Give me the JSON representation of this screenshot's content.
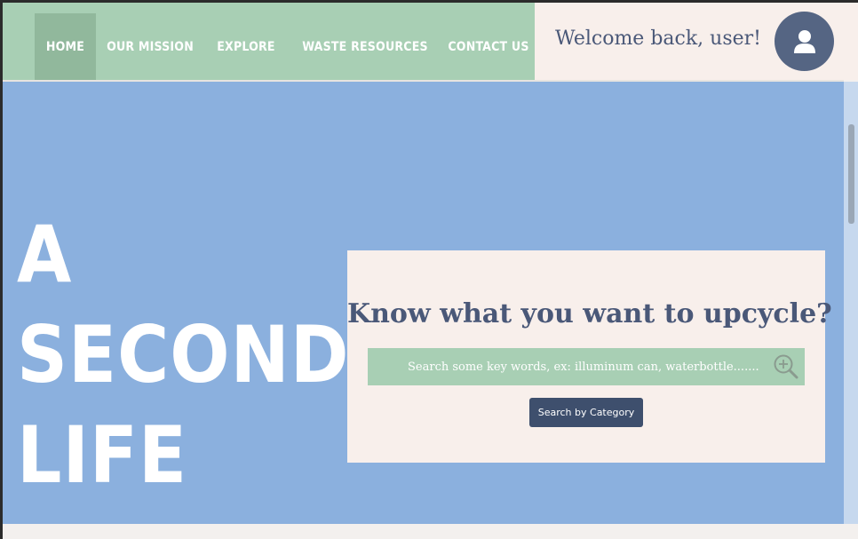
{
  "nav": {
    "items": [
      {
        "label": "HOME",
        "active": true
      },
      {
        "label": "OUR MISSION"
      },
      {
        "label": "EXPLORE"
      },
      {
        "label": "WASTE RESOURCES"
      },
      {
        "label": "CONTACT US"
      }
    ]
  },
  "header": {
    "welcome": "Welcome back, user!",
    "avatar_icon": "user-icon"
  },
  "hero": {
    "title_lines": [
      "A",
      "SECOND",
      "LIFE"
    ]
  },
  "search": {
    "heading": "Know what you want to upcycle?",
    "placeholder": "Search some key words, ex: illuminum can, waterbottle.......",
    "icon": "zoom-in-icon",
    "category_button": "Search by Category"
  },
  "colors": {
    "nav_bg": "#a8cfb4",
    "hero_bg": "#8bb0de",
    "card_bg": "#f8efeb",
    "accent_dark": "#3e4f6d",
    "text_navy": "#4a5878"
  }
}
